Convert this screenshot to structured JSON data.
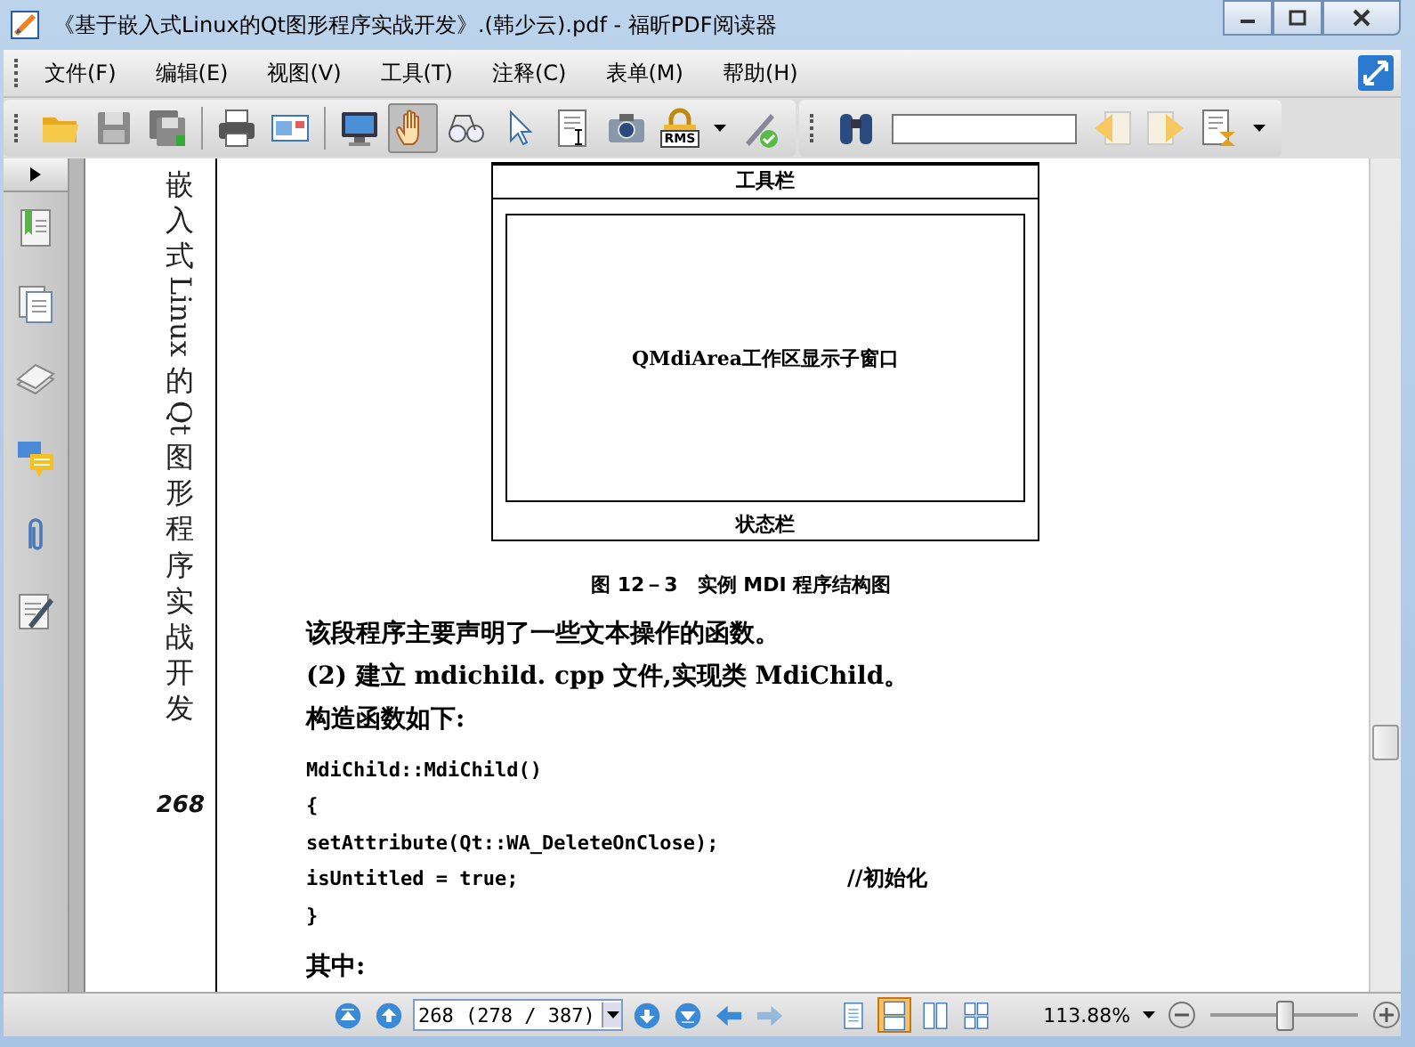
{
  "window": {
    "title": "《基于嵌入式Linux的Qt图形程序实战开发》.(韩少云).pdf - 福昕PDF阅读器"
  },
  "menu": [
    {
      "label": "文件(F)"
    },
    {
      "label": "编辑(E)"
    },
    {
      "label": "视图(V)"
    },
    {
      "label": "工具(T)"
    },
    {
      "label": "注释(C)"
    },
    {
      "label": "表单(M)"
    },
    {
      "label": "帮助(H)"
    }
  ],
  "toolbar": {
    "tools": [
      {
        "kind": "open",
        "selected": false
      },
      {
        "kind": "save",
        "selected": false
      },
      {
        "kind": "save-all",
        "selected": false
      },
      {
        "kind": "sep"
      },
      {
        "kind": "print",
        "selected": false
      },
      {
        "kind": "email",
        "selected": false
      },
      {
        "kind": "sep"
      },
      {
        "kind": "monitor",
        "selected": false
      },
      {
        "kind": "hand",
        "selected": true
      },
      {
        "kind": "glasses",
        "selected": false
      },
      {
        "kind": "pointer",
        "selected": false
      },
      {
        "kind": "text-select",
        "selected": false
      },
      {
        "kind": "camera",
        "selected": false
      },
      {
        "kind": "rms",
        "selected": false,
        "label": "RMS"
      },
      {
        "kind": "caret"
      },
      {
        "kind": "pen",
        "selected": false
      }
    ],
    "find_tools": [
      {
        "kind": "binoculars"
      },
      {
        "kind": "search-field"
      },
      {
        "kind": "prev-result"
      },
      {
        "kind": "next-result"
      },
      {
        "kind": "find-options"
      },
      {
        "kind": "caret"
      }
    ]
  },
  "sidebar": {
    "items": [
      {
        "kind": "bookmarks"
      },
      {
        "kind": "pages"
      },
      {
        "kind": "layers"
      },
      {
        "kind": "comments"
      },
      {
        "kind": "attachments"
      },
      {
        "kind": "signatures"
      }
    ]
  },
  "document": {
    "vertical_title": "嵌入式Linux的Qt图形程序实战开发",
    "page_number": "268",
    "figure": {
      "toolbar_label": "工具栏",
      "area_label": "QMdiArea工作区显示子窗口",
      "status_label": "状态栏",
      "caption": "图 12－3　实例 MDI 程序结构图"
    },
    "lines": [
      {
        "kind": "text",
        "text": "该段程序主要声明了一些文本操作的函数。"
      },
      {
        "kind": "text",
        "text": "(2) 建立 mdichild. cpp 文件,实现类 MdiChild。"
      },
      {
        "kind": "text",
        "text": "构造函数如下:"
      },
      {
        "kind": "code",
        "text": "MdiChild::MdiChild()"
      },
      {
        "kind": "code",
        "text": "{"
      },
      {
        "kind": "code",
        "text": "setAttribute(Qt::WA_DeleteOnClose);"
      },
      {
        "kind": "code",
        "text": "isUntitled = true;",
        "comment": "//初始化"
      },
      {
        "kind": "code",
        "text": "}"
      },
      {
        "kind": "text",
        "text": "其中:"
      }
    ]
  },
  "status_bar": {
    "page_field": "268 (278 / 387)",
    "zoom": "113.88%",
    "views": [
      {
        "kind": "single",
        "selected": false
      },
      {
        "kind": "continuous",
        "selected": true
      },
      {
        "kind": "facing",
        "selected": false
      },
      {
        "kind": "continuous-facing",
        "selected": false
      }
    ],
    "nav": [
      {
        "kind": "first",
        "disabled": false
      },
      {
        "kind": "prev",
        "disabled": false
      }
    ],
    "nav_after": [
      {
        "kind": "next",
        "disabled": false
      },
      {
        "kind": "last",
        "disabled": false
      },
      {
        "kind": "back",
        "disabled": false
      },
      {
        "kind": "forward",
        "disabled": true
      }
    ],
    "zoom_slider": {
      "level": 0.5
    }
  }
}
